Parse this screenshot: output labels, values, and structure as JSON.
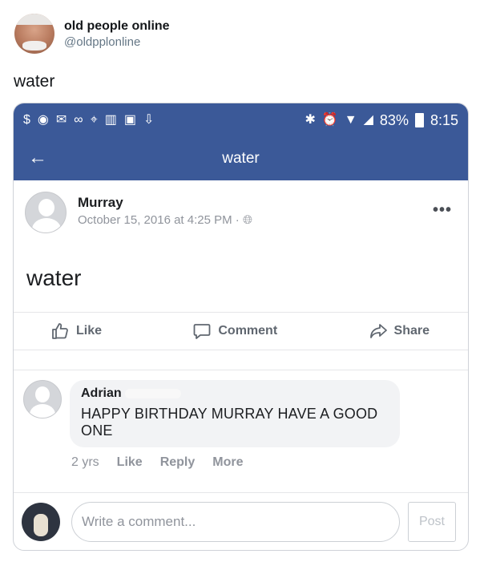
{
  "tweet": {
    "name": "old people online",
    "handle": "@oldpplonline",
    "text": "water"
  },
  "status_bar": {
    "battery": "83%",
    "time": "8:15"
  },
  "title_bar": {
    "title": "water"
  },
  "post": {
    "author": "Murray",
    "timestamp": "October 15, 2016 at 4:25 PM ·",
    "body": "water",
    "actions": {
      "like": "Like",
      "comment": "Comment",
      "share": "Share"
    }
  },
  "comment": {
    "author": "Adrian",
    "text": "HAPPY BIRTHDAY MURRAY HAVE A GOOD ONE",
    "age": "2 yrs",
    "like": "Like",
    "reply": "Reply",
    "more": "More"
  },
  "composer": {
    "placeholder": "Write a comment...",
    "post": "Post"
  },
  "colors": {
    "facebook_blue": "#3b5998",
    "meta_gray": "#90949c",
    "bubble_bg": "#f2f3f5"
  }
}
